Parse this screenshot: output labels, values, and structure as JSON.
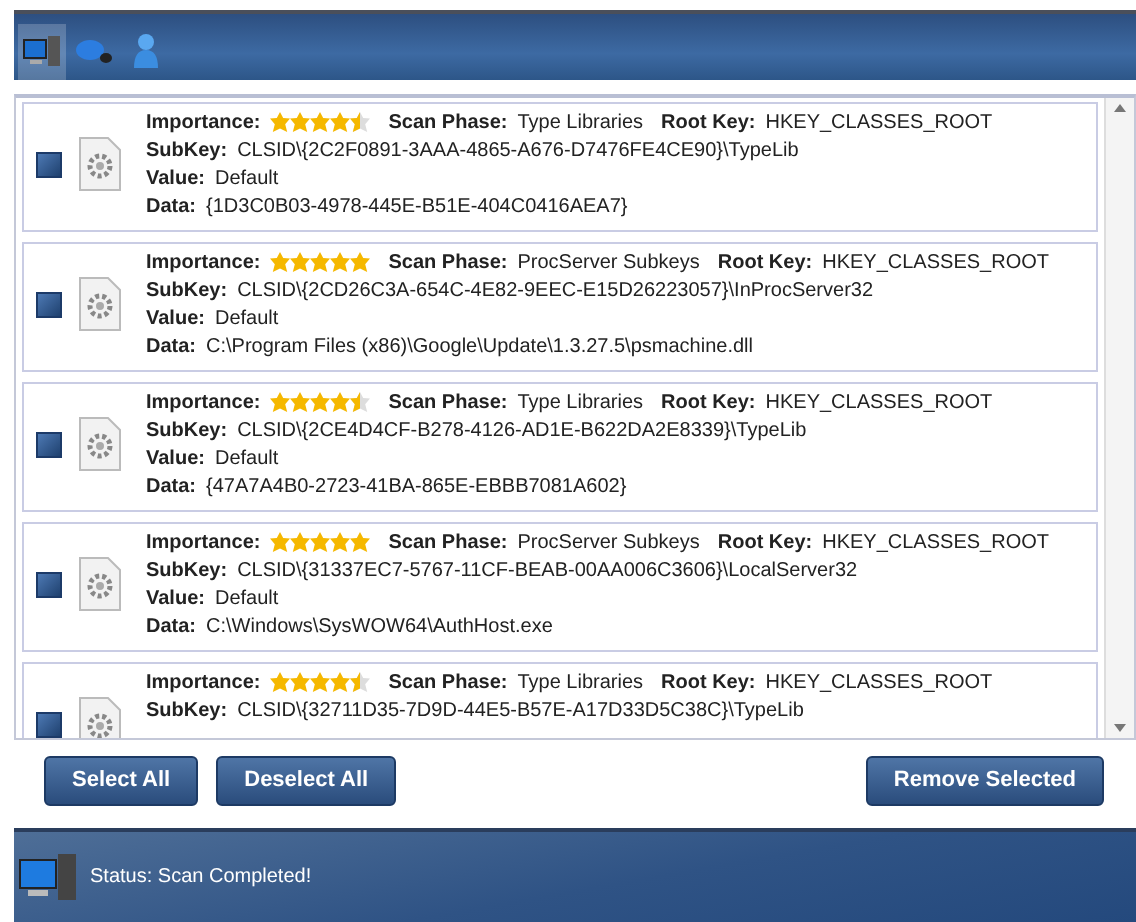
{
  "toolbar": {
    "tabs": [
      {
        "kind": "computer",
        "selected": true
      },
      {
        "kind": "mouse",
        "selected": false
      },
      {
        "kind": "person",
        "selected": false
      }
    ]
  },
  "results": [
    {
      "checked": true,
      "stars": 4.5,
      "importance_label": "Importance:",
      "phase_label": "Scan Phase:",
      "phase": "Type Libraries",
      "root_label": "Root Key:",
      "root": "HKEY_CLASSES_ROOT",
      "subkey_label": "SubKey:",
      "subkey": "CLSID\\{2C2F0891-3AAA-4865-A676-D7476FE4CE90}\\TypeLib",
      "value_label": "Value:",
      "value": "Default",
      "data_label": "Data:",
      "data": "{1D3C0B03-4978-445E-B51E-404C0416AEA7}"
    },
    {
      "checked": true,
      "stars": 5,
      "importance_label": "Importance:",
      "phase_label": "Scan Phase:",
      "phase": "ProcServer Subkeys",
      "root_label": "Root Key:",
      "root": "HKEY_CLASSES_ROOT",
      "subkey_label": "SubKey:",
      "subkey": "CLSID\\{2CD26C3A-654C-4E82-9EEC-E15D26223057}\\InProcServer32",
      "value_label": "Value:",
      "value": "Default",
      "data_label": "Data:",
      "data": "C:\\Program Files (x86)\\Google\\Update\\1.3.27.5\\psmachine.dll"
    },
    {
      "checked": true,
      "stars": 4.5,
      "importance_label": "Importance:",
      "phase_label": "Scan Phase:",
      "phase": "Type Libraries",
      "root_label": "Root Key:",
      "root": "HKEY_CLASSES_ROOT",
      "subkey_label": "SubKey:",
      "subkey": "CLSID\\{2CE4D4CF-B278-4126-AD1E-B622DA2E8339}\\TypeLib",
      "value_label": "Value:",
      "value": "Default",
      "data_label": "Data:",
      "data": "{47A7A4B0-2723-41BA-865E-EBBB7081A602}"
    },
    {
      "checked": true,
      "stars": 5,
      "importance_label": "Importance:",
      "phase_label": "Scan Phase:",
      "phase": "ProcServer Subkeys",
      "root_label": "Root Key:",
      "root": "HKEY_CLASSES_ROOT",
      "subkey_label": "SubKey:",
      "subkey": "CLSID\\{31337EC7-5767-11CF-BEAB-00AA006C3606}\\LocalServer32",
      "value_label": "Value:",
      "value": "Default",
      "data_label": "Data:",
      "data": "C:\\Windows\\SysWOW64\\AuthHost.exe"
    },
    {
      "checked": true,
      "stars": 4.5,
      "importance_label": "Importance:",
      "phase_label": "Scan Phase:",
      "phase": "Type Libraries",
      "root_label": "Root Key:",
      "root": "HKEY_CLASSES_ROOT",
      "subkey_label": "SubKey:",
      "subkey": "CLSID\\{32711D35-7D9D-44E5-B57E-A17D33D5C38C}\\TypeLib"
    }
  ],
  "buttons": [
    {
      "kind": "left",
      "label": "Select All"
    },
    {
      "kind": "left",
      "label": "Deselect All"
    },
    {
      "kind": "right",
      "label": "Remove Selected"
    }
  ],
  "status": "Status: Scan Completed!"
}
